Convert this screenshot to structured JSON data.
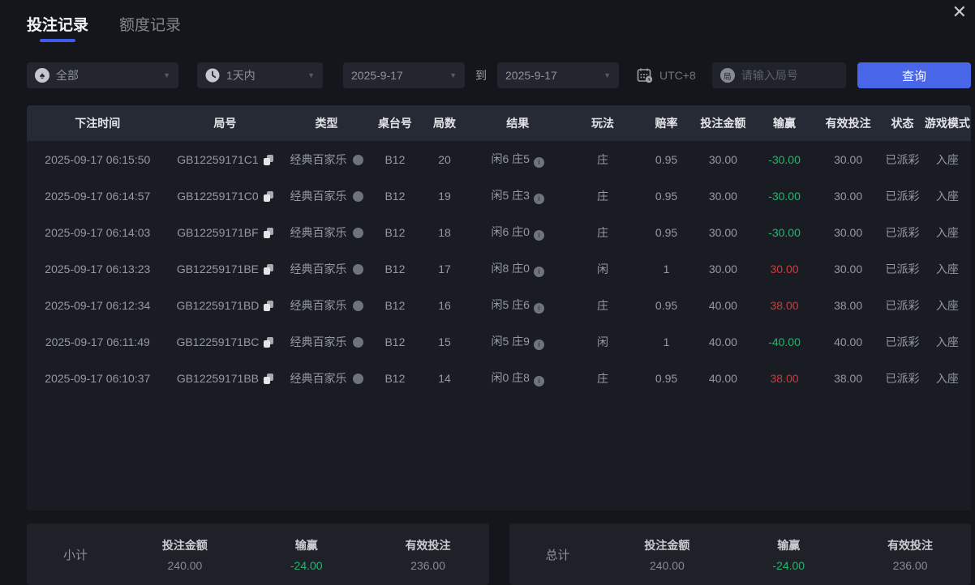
{
  "window": {
    "close_icon": "✕"
  },
  "tabs": [
    {
      "label": "投注记录",
      "active": true
    },
    {
      "label": "额度记录",
      "active": false
    }
  ],
  "filters": {
    "game_type": {
      "value": "全部",
      "icon": "spade-icon"
    },
    "time_range": {
      "value": "1天内",
      "icon": "clock-icon"
    },
    "date_from": "2025-9-17",
    "to_label": "到",
    "date_to": "2025-9-17",
    "timezone_label": "UTC+8",
    "round_icon_char": "局",
    "round_input_placeholder": "请输入局号",
    "query_button_label": "查询"
  },
  "table": {
    "headers": [
      "下注时间",
      "局号",
      "类型",
      "桌台号",
      "局数",
      "结果",
      "玩法",
      "赔率",
      "投注金额",
      "输赢",
      "有效投注",
      "状态",
      "游戏模式"
    ],
    "rows": [
      {
        "time": "2025-09-17 06:15:50",
        "round_id": "GB12259171C1",
        "game_type": "经典百家乐",
        "table_no": "B12",
        "round_no": "20",
        "result": "闲6 庄5",
        "play": "庄",
        "odds": "0.95",
        "bet_amount": "30.00",
        "win_loss": "-30.00",
        "valid_bet": "30.00",
        "status": "已派彩",
        "game_mode": "入座"
      },
      {
        "time": "2025-09-17 06:14:57",
        "round_id": "GB12259171C0",
        "game_type": "经典百家乐",
        "table_no": "B12",
        "round_no": "19",
        "result": "闲5 庄3",
        "play": "庄",
        "odds": "0.95",
        "bet_amount": "30.00",
        "win_loss": "-30.00",
        "valid_bet": "30.00",
        "status": "已派彩",
        "game_mode": "入座"
      },
      {
        "time": "2025-09-17 06:14:03",
        "round_id": "GB12259171BF",
        "game_type": "经典百家乐",
        "table_no": "B12",
        "round_no": "18",
        "result": "闲6 庄0",
        "play": "庄",
        "odds": "0.95",
        "bet_amount": "30.00",
        "win_loss": "-30.00",
        "valid_bet": "30.00",
        "status": "已派彩",
        "game_mode": "入座"
      },
      {
        "time": "2025-09-17 06:13:23",
        "round_id": "GB12259171BE",
        "game_type": "经典百家乐",
        "table_no": "B12",
        "round_no": "17",
        "result": "闲8 庄0",
        "play": "闲",
        "odds": "1",
        "bet_amount": "30.00",
        "win_loss": "30.00",
        "valid_bet": "30.00",
        "status": "已派彩",
        "game_mode": "入座"
      },
      {
        "time": "2025-09-17 06:12:34",
        "round_id": "GB12259171BD",
        "game_type": "经典百家乐",
        "table_no": "B12",
        "round_no": "16",
        "result": "闲5 庄6",
        "play": "庄",
        "odds": "0.95",
        "bet_amount": "40.00",
        "win_loss": "38.00",
        "valid_bet": "38.00",
        "status": "已派彩",
        "game_mode": "入座"
      },
      {
        "time": "2025-09-17 06:11:49",
        "round_id": "GB12259171BC",
        "game_type": "经典百家乐",
        "table_no": "B12",
        "round_no": "15",
        "result": "闲5 庄9",
        "play": "闲",
        "odds": "1",
        "bet_amount": "40.00",
        "win_loss": "-40.00",
        "valid_bet": "40.00",
        "status": "已派彩",
        "game_mode": "入座"
      },
      {
        "time": "2025-09-17 06:10:37",
        "round_id": "GB12259171BB",
        "game_type": "经典百家乐",
        "table_no": "B12",
        "round_no": "14",
        "result": "闲0 庄8",
        "play": "庄",
        "odds": "0.95",
        "bet_amount": "40.00",
        "win_loss": "38.00",
        "valid_bet": "38.00",
        "status": "已派彩",
        "game_mode": "入座"
      }
    ]
  },
  "summary": {
    "subtotal": {
      "label": "小计",
      "bet_label": "投注金额",
      "bet_value": "240.00",
      "win_label": "输赢",
      "win_value": "-24.00",
      "valid_label": "有效投注",
      "valid_value": "236.00"
    },
    "total": {
      "label": "总计",
      "bet_label": "投注金额",
      "bet_value": "240.00",
      "win_label": "输赢",
      "win_value": "-24.00",
      "valid_label": "有效投注",
      "valid_value": "236.00"
    }
  },
  "colors": {
    "accent_blue": "#4a66e8",
    "win_red": "#d03b3b",
    "loss_green": "#27b56f"
  }
}
